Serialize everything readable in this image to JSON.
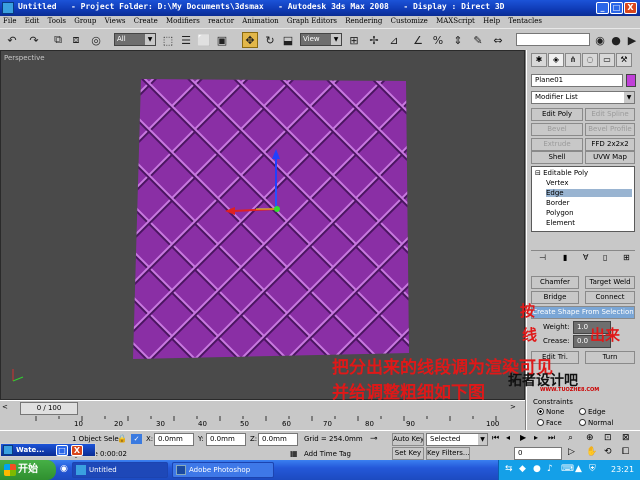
{
  "title_bar": {
    "text": "Untitled   - Project Folder: D:\\My Documents\\3dsmax   - Autodesk 3ds Max 2008   - Display : Direct 3D",
    "buttons": [
      "_",
      "□",
      "X"
    ]
  },
  "menu": [
    "File",
    "Edit",
    "Tools",
    "Group",
    "Views",
    "Create",
    "Modifiers",
    "reactor",
    "Animation",
    "Graph Editors",
    "Rendering",
    "Customize",
    "MAXScript",
    "Help",
    "Tentacles"
  ],
  "toolbar": {
    "selection_filter": "All",
    "ref_coord": "View"
  },
  "viewport": {
    "label": "Perspective",
    "object_color": "#8a2fa5",
    "seam_color": "#c97ae0"
  },
  "command_panel": {
    "object_name": "Plane01",
    "object_color": "#c040d8",
    "modifier_list": "Modifier List",
    "buttons": {
      "edit_poly": "Edit Poly",
      "edit_spline": "Edit Spline",
      "bevel": "Bevel",
      "bevel_profile": "Bevel Profile",
      "extrude": "Extrude",
      "ffd": "FFD 2x2x2",
      "shell": "Shell",
      "uvw_map": "UVW Map"
    },
    "stack": {
      "root": "Editable Poly",
      "items": [
        "Vertex",
        "Edge",
        "Border",
        "Polygon",
        "Element"
      ],
      "selected": "Edge"
    },
    "edit_edges": {
      "chamfer": "Chamfer",
      "target_weld": "Target Weld",
      "bridge": "Bridge",
      "connect": "Connect",
      "create_shape": "Create Shape From Selection",
      "weight_label": "Weight:",
      "weight_value": "1.0",
      "crease_label": "Crease:",
      "crease_value": "0.0",
      "edit_tri": "Edit Tri.",
      "turn": "Turn"
    },
    "constraints": {
      "label": "Constraints",
      "options": [
        "None",
        "Edge",
        "Face",
        "Normal"
      ],
      "selected": "None"
    }
  },
  "overlay_text": {
    "panel_line1": "按",
    "panel_line2": "线",
    "panel_line3": "出来",
    "main_line1": "把分出来的线段调为渲染可见",
    "main_line2": "并给调整粗细如下图",
    "logo": "拓者设计吧",
    "logo_url": "WWW.TUOZHE8.COM"
  },
  "timeline": {
    "frame": "0 / 100",
    "ticks": [
      "0",
      "10",
      "20",
      "30",
      "40",
      "50",
      "60",
      "70",
      "80",
      "90",
      "100"
    ]
  },
  "status": {
    "selected": "1 Object Sele",
    "x_label": "X:",
    "x_value": "0.0mm",
    "y_label": "Y:",
    "y_value": "0.0mm",
    "z_label": "Z:",
    "z_value": "0.0mm",
    "grid": "Grid = 254.0mm",
    "auto_key": "Auto Key",
    "selected_dropdown": "Selected",
    "set_key": "Set Key",
    "key_filters": "Key Filters...",
    "render_time": "g Time 0:00:02",
    "add_time_tag": "Add Time Tag",
    "frame_value": "0"
  },
  "mini_window": {
    "title": "Wate...",
    "buttons": [
      "□",
      "X"
    ]
  },
  "taskbar": {
    "start": "开始",
    "tasks": [
      "Untitled",
      "Adobe Photoshop"
    ],
    "time": "23:21"
  }
}
